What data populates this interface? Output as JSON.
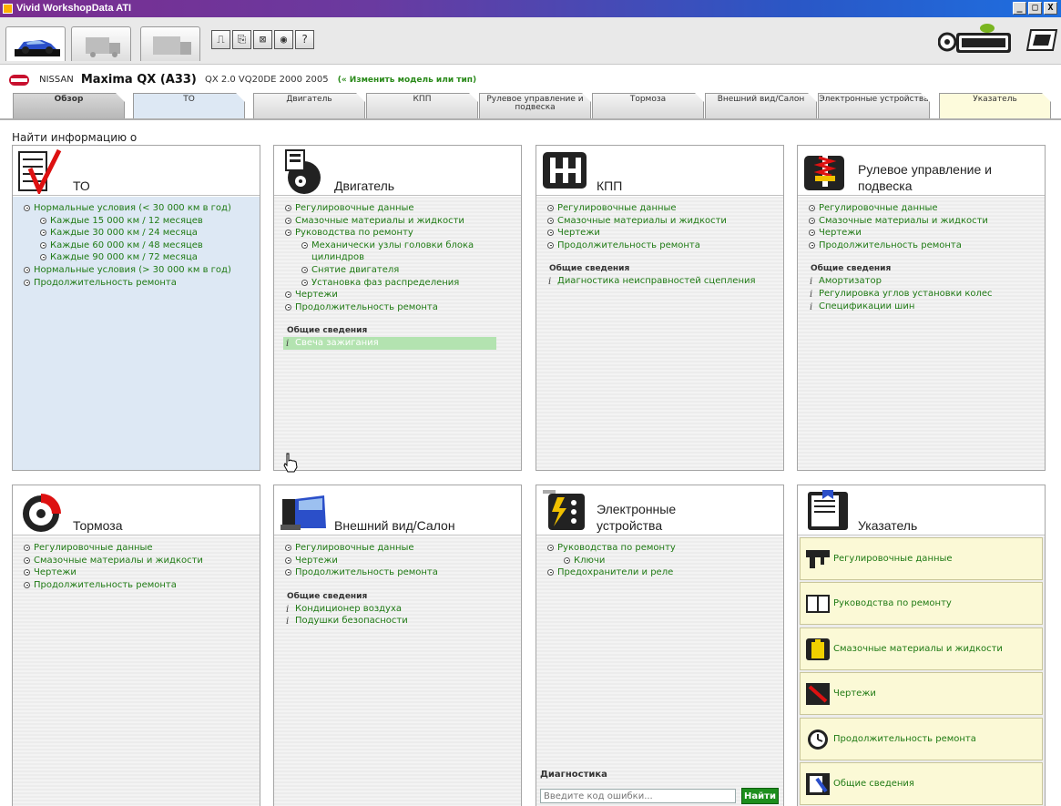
{
  "window": {
    "title": "Vivid WorkshopData ATI",
    "minimize": "_",
    "maximize": "□",
    "close": "X"
  },
  "toolbar": {
    "buttons": [
      "⎍",
      "⎘",
      "⊠",
      "◉",
      "?"
    ]
  },
  "vehicle": {
    "make": "NISSAN",
    "model": "Maxima QX (A33)",
    "spec": "QX 2.0 VQ20DE 2000 2005",
    "change_link": "(« Изменить модель или тип)"
  },
  "tabs": [
    {
      "label": "Обзор"
    },
    {
      "label": "ТО"
    },
    {
      "label": "Двигатель"
    },
    {
      "label": "КПП"
    },
    {
      "label": "Рулевое управление и подвеска"
    },
    {
      "label": "Тормоза"
    },
    {
      "label": "Внешний вид/Салон"
    },
    {
      "label": "Электронные устройства"
    },
    {
      "label": "Указатель"
    }
  ],
  "find_label": "Найти информацию о",
  "cards": {
    "to": {
      "title": "ТО",
      "links": [
        "Нормальные условия (< 30 000 км в год)",
        "Каждые 15 000 км / 12 месяцев",
        "Каждые 30 000 км / 24 месяца",
        "Каждые 60 000 км / 48 месяцев",
        "Каждые 90 000 км / 72 месяца",
        "Нормальные условия (> 30 000 км в год)",
        "Продолжительность ремонта"
      ]
    },
    "engine": {
      "title": "Двигатель",
      "links": [
        "Регулировочные данные",
        "Смазочные материалы и жидкости",
        "Руководства по ремонту",
        "Механически узлы головки блока",
        "цилиндров",
        "Снятие двигателя",
        "Установка фаз распределения",
        "Чертежи",
        "Продолжительность ремонта"
      ],
      "general_head": "Общие сведения",
      "general": [
        "Свеча зажигания"
      ]
    },
    "gearbox": {
      "title": "КПП",
      "links": [
        "Регулировочные данные",
        "Смазочные материалы и жидкости",
        "Чертежи",
        "Продолжительность ремонта"
      ],
      "general_head": "Общие сведения",
      "general": [
        "Диагностика неисправностей сцепления"
      ]
    },
    "steering": {
      "title_line1": "Рулевое управление и",
      "title_line2": "подвеска",
      "links": [
        "Регулировочные данные",
        "Смазочные материалы и жидкости",
        "Чертежи",
        "Продолжительность ремонта"
      ],
      "general_head": "Общие сведения",
      "general": [
        "Амортизатор",
        "Регулировка углов установки колес",
        "Спецификации шин"
      ]
    },
    "brakes": {
      "title": "Тормоза",
      "links": [
        "Регулировочные данные",
        "Смазочные материалы и жидкости",
        "Чертежи",
        "Продолжительность ремонта"
      ]
    },
    "body": {
      "title": "Внешний вид/Салон",
      "links": [
        "Регулировочные данные",
        "Чертежи",
        "Продолжительность ремонта"
      ],
      "general_head": "Общие сведения",
      "general": [
        "Кондиционер воздуха",
        "Подушки безопасности"
      ]
    },
    "electronics": {
      "title_line1": "Электронные",
      "title_line2": "устройства",
      "links": [
        "Руководства по ремонту",
        "Ключи",
        "Предохранители и реле"
      ],
      "diag_label": "Диагностика",
      "diag_placeholder": "Введите код ошибки...",
      "diag_button": "Найти"
    },
    "index": {
      "title": "Указатель",
      "items": [
        "Регулировочные данные",
        "Руководства по ремонту",
        "Смазочные материалы и жидкости",
        "Чертежи",
        "Продолжительность ремонта",
        "Общие сведения"
      ]
    }
  },
  "colors": {
    "link": "#1f7a14",
    "to_bg": "#dde8f4",
    "index_bg": "#fbf9d6",
    "button": "#1d8e1d"
  }
}
